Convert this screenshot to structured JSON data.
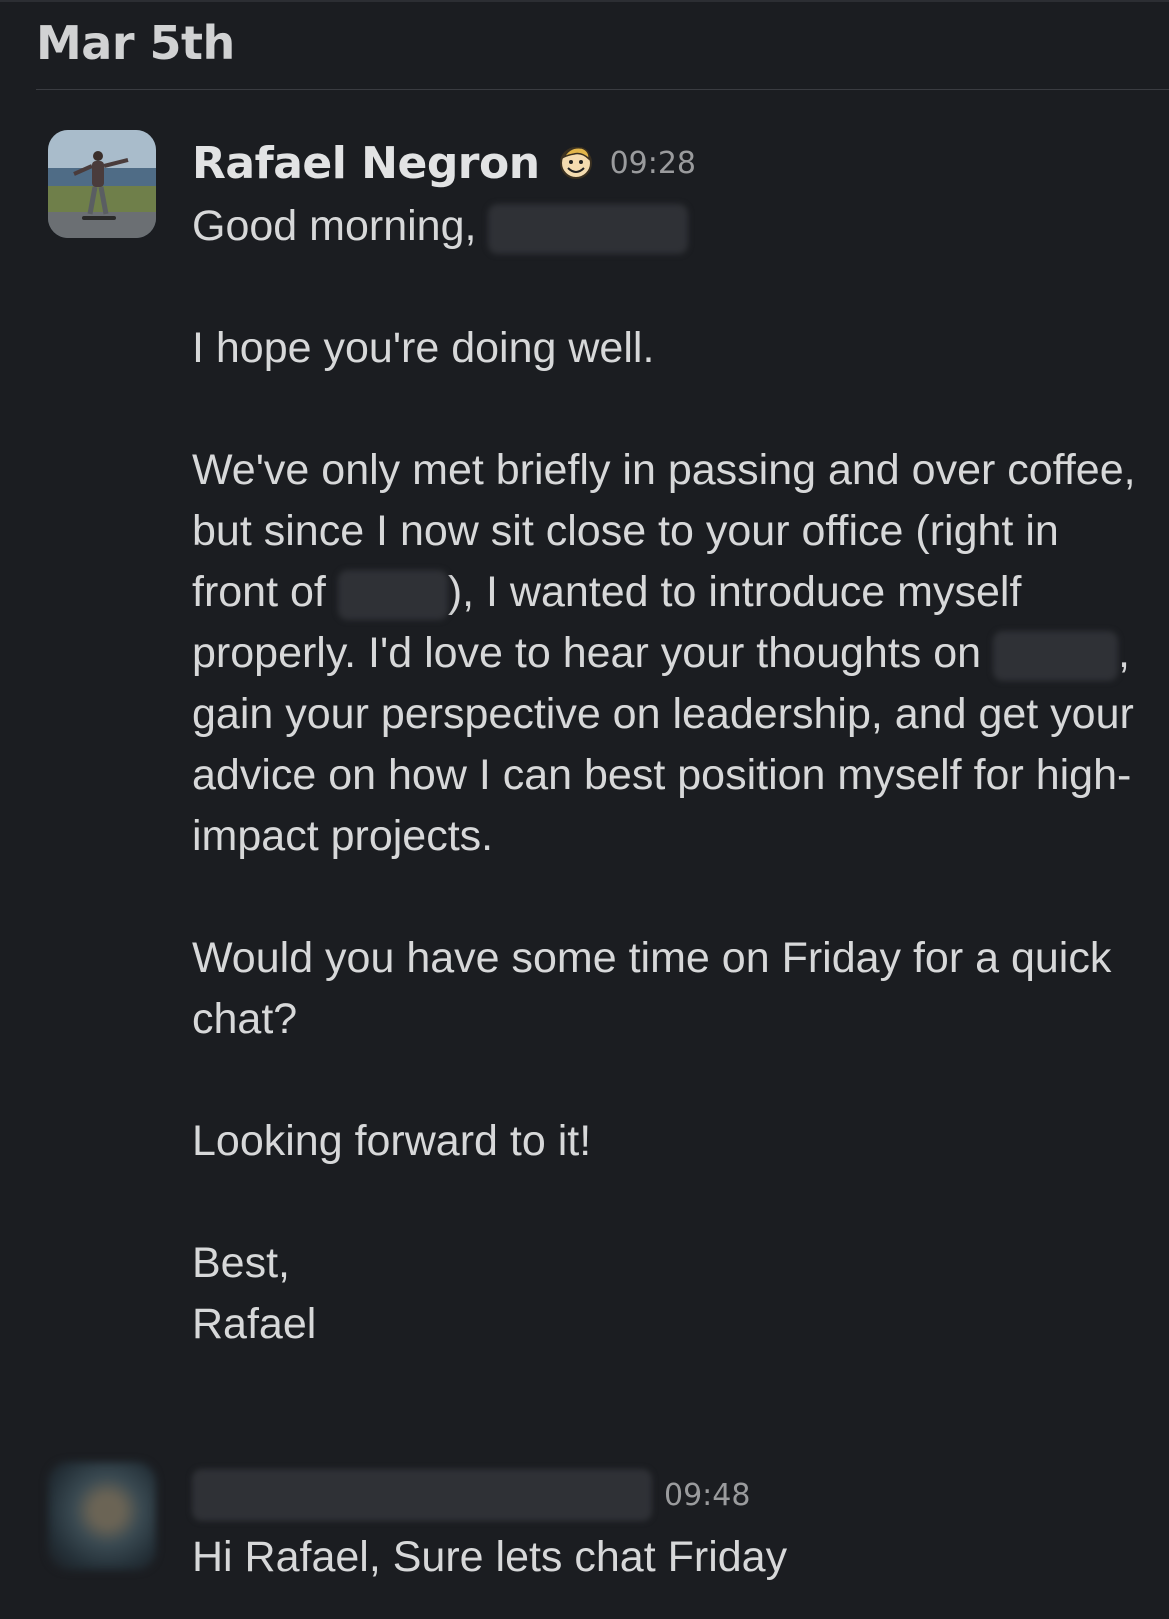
{
  "date_header": "Mar 5th",
  "messages": [
    {
      "sender": "Rafael Negron",
      "status_emoji": "vault-boy-emoji",
      "time": "09:28",
      "lines": {
        "greeting": "Good morning,",
        "p1": "I hope you're doing well.",
        "p2a": "We've only met briefly in passing and over coffee, but since I now sit close to your office (right in front of",
        "p2b": "), I wanted to introduce myself properly. I'd love to hear your thoughts on",
        "p2c": ", gain your perspective on leadership, and get your advice on how I can best position myself for high-impact projects.",
        "p3": "Would you have some time on Friday for a quick chat?",
        "p4": "Looking forward to it!",
        "sign1": "Best,",
        "sign2": "Rafael"
      }
    },
    {
      "sender_redacted": true,
      "time": "09:48",
      "text": "Hi Rafael, Sure lets chat Friday"
    }
  ]
}
